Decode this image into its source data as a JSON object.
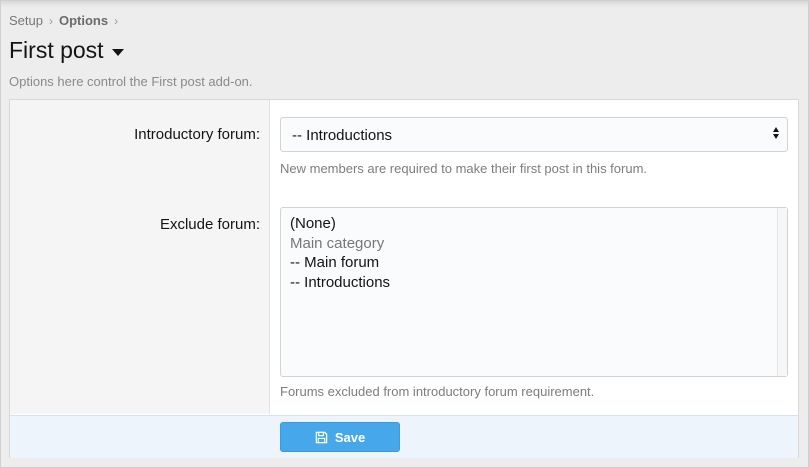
{
  "breadcrumb": [
    {
      "label": "Setup"
    },
    {
      "label": "Options"
    }
  ],
  "page": {
    "title": "First post",
    "description": "Options here control the First post add-on."
  },
  "form": {
    "introductory": {
      "label": "Introductory forum:",
      "selected": "-- Introductions",
      "hint": "New members are required to make their first post in this forum."
    },
    "exclude": {
      "label": "Exclude forum:",
      "options": [
        "(None)",
        "Main category",
        "-- Main forum",
        "-- Introductions"
      ],
      "hint": "Forums excluded from introductory forum requirement."
    }
  },
  "footer": {
    "save_label": "Save",
    "save_icon": "floppy-disk-icon"
  },
  "colors": {
    "accent": "#47a7eb",
    "footer_bg": "#edf4fb"
  }
}
